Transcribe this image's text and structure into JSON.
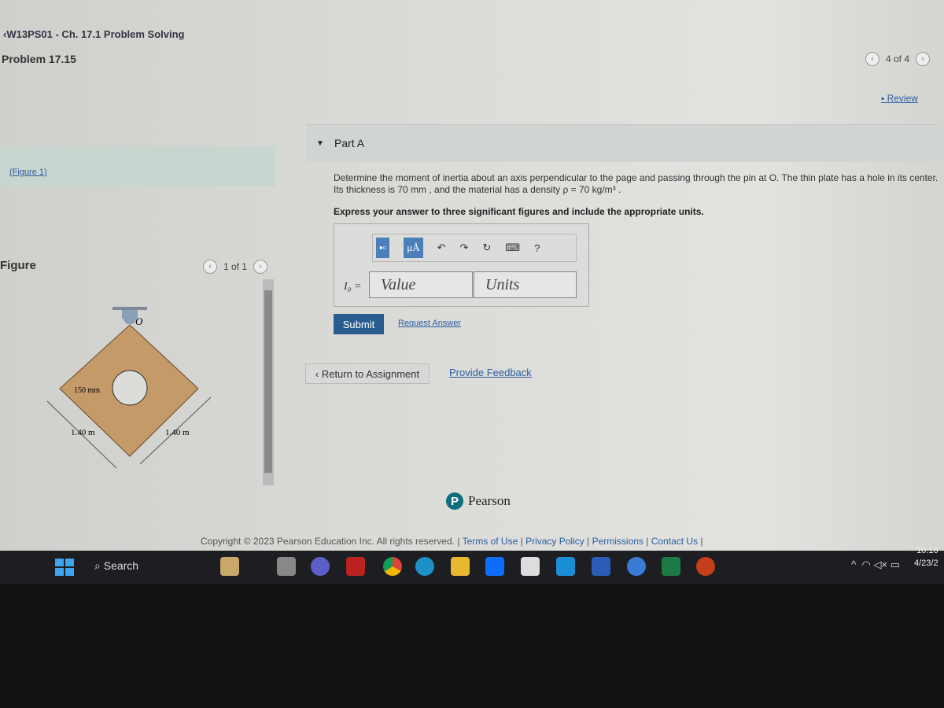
{
  "header": {
    "breadcrumb": "W13PS01 - Ch. 17.1 Problem Solving",
    "problem": "Problem 17.15",
    "pager": "4 of 4",
    "review": "Review"
  },
  "figure_panel": {
    "link": "(Figure 1)",
    "label": "Figure",
    "pager": "1 of 1",
    "hole_label": "150 mm",
    "side_left": "1.40 m",
    "side_right": "1.40 m",
    "pin_label": "O"
  },
  "part": {
    "title": "Part A",
    "question": "Determine the moment of inertia about an axis perpendicular to the page and passing through the pin at O. The thin plate has a hole in its center. Its thickness is 70 mm , and the material has a density ρ = 70 kg/m³ .",
    "instruction": "Express your answer to three significant figures and include the appropriate units."
  },
  "answer": {
    "tools": [
      "templates",
      "μÅ",
      "undo",
      "redo",
      "reset",
      "keyboard",
      "?"
    ],
    "label": "I₀ =",
    "value_placeholder": "Value",
    "units_placeholder": "Units"
  },
  "buttons": {
    "submit": "Submit",
    "request": "Request Answer",
    "return": "Return to Assignment",
    "feedback": "Provide Feedback"
  },
  "footer": {
    "brand": "Pearson",
    "copyright": "Copyright © 2023 Pearson Education Inc. All rights reserved.",
    "links": [
      "Terms of Use",
      "Privacy Policy",
      "Permissions",
      "Contact Us"
    ]
  },
  "taskbar": {
    "search": "Search",
    "time": "10:16",
    "date": "4/23/2"
  }
}
